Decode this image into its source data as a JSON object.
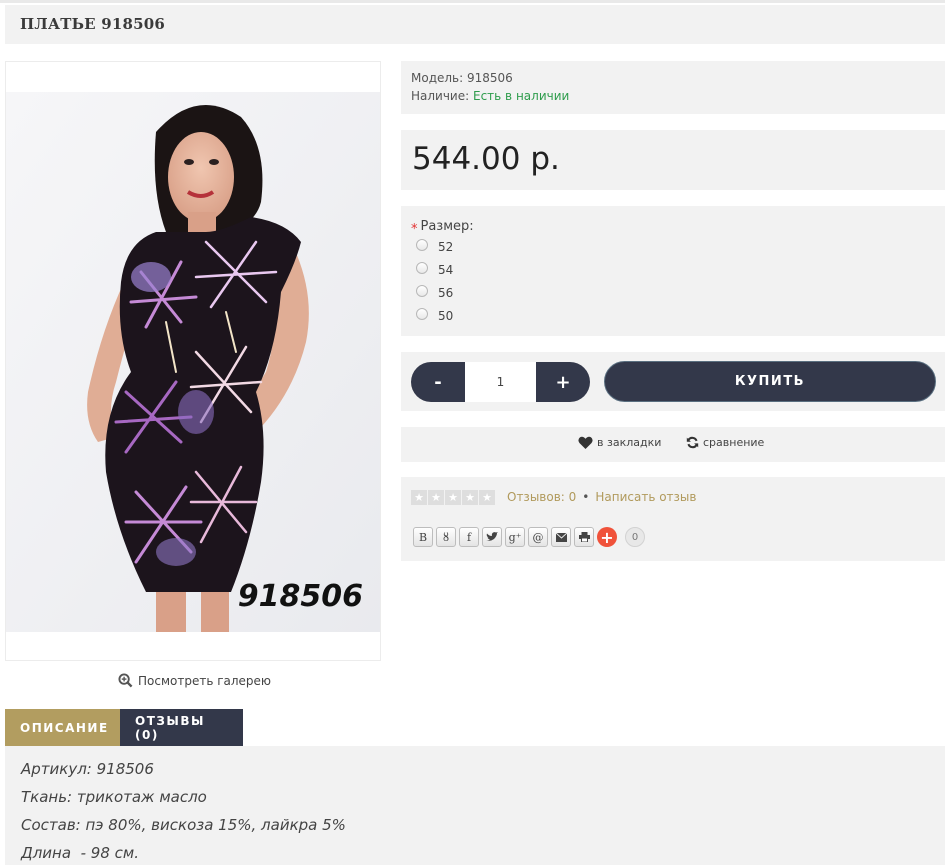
{
  "product": {
    "title": "ПЛАТЬЕ 918506",
    "image_code": "918506",
    "gallery_label": "Посмотреть галерею"
  },
  "info": {
    "model_label": "Модель:",
    "model_value": "918506",
    "stock_label": "Наличие:",
    "stock_value": "Есть в наличии"
  },
  "price": "544.00 р.",
  "size": {
    "label": "Размер:",
    "options": [
      "52",
      "54",
      "56",
      "50"
    ]
  },
  "buy": {
    "minus": "-",
    "plus": "+",
    "qty": "1",
    "button": "КУПИТЬ"
  },
  "actions": {
    "bookmark": "в закладки",
    "compare": "сравнение"
  },
  "reviews": {
    "count_text": "Отзывов: 0",
    "separator": "•",
    "write": "Написать отзыв",
    "share_count": "0"
  },
  "share_icons": [
    "vk-icon",
    "odnoklassniki-icon",
    "facebook-icon",
    "twitter-icon",
    "googleplus-icon",
    "mailru-icon",
    "email-icon",
    "print-icon",
    "addthis-icon"
  ],
  "tabs": {
    "description": "ОПИСАНИЕ",
    "reviews": "ОТЗЫВЫ (0)"
  },
  "description": {
    "line1": "Артикул: 918506",
    "line2": "Ткань: трикотаж масло",
    "line3": "Состав: пэ 80%, вискоза 15%, лайкра 5%",
    "line4": "Длина  - 98 см."
  },
  "colors": {
    "dark_button": "#33384a",
    "gold_accent": "#b29d60",
    "in_stock": "#2e9c4c",
    "panel_bg": "#f2f2f2"
  }
}
